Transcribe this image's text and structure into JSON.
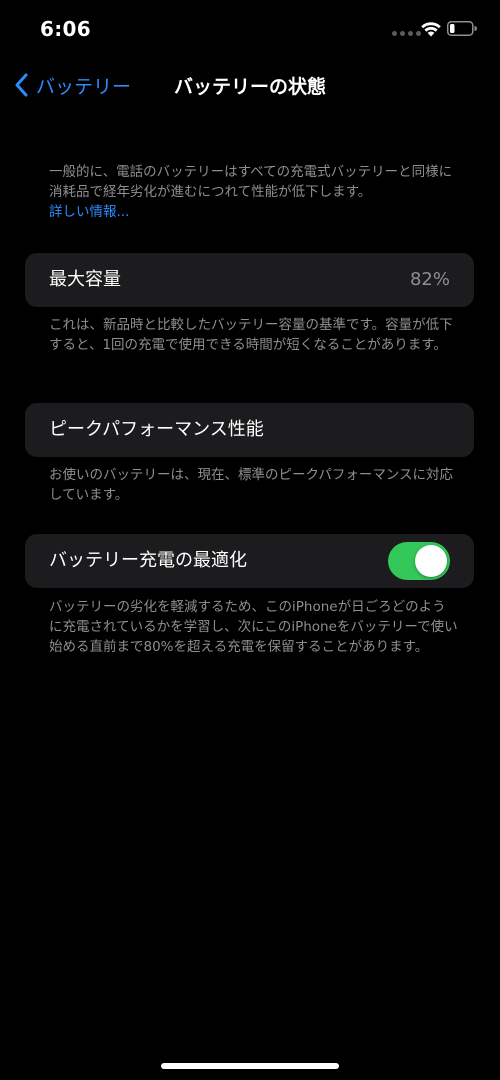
{
  "status_bar": {
    "time": "6:06",
    "icons": [
      "signal-dots-icon",
      "wifi-icon",
      "battery-icon"
    ]
  },
  "nav": {
    "back_label": "バッテリー",
    "title": "バッテリーの状態"
  },
  "intro": {
    "text": "一般的に、電話のバッテリーはすべての充電式バッテリーと同様に消耗品で経年劣化が進むにつれて性能が低下します。",
    "link": "詳しい情報..."
  },
  "max_capacity": {
    "label": "最大容量",
    "value": "82%",
    "footnote": "これは、新品時と比較したバッテリー容量の基準です。容量が低下すると、1回の充電で使用できる時間が短くなることがあります。"
  },
  "peak_performance": {
    "label": "ピークパフォーマンス性能",
    "footnote": "お使いのバッテリーは、現在、標準のピークパフォーマンスに対応しています。"
  },
  "optimized_charging": {
    "label": "バッテリー充電の最適化",
    "enabled": true,
    "footnote": "バッテリーの劣化を軽減するため、このiPhoneが日ごろどのように充電されているかを学習し、次にこのiPhoneをバッテリーで使い始める直前まで80%を超える充電を保留することがあります。"
  },
  "colors": {
    "background": "#000000",
    "card": "#1c1c1e",
    "accent": "#2c8cff",
    "toggle_on": "#34c759",
    "secondary_text": "#8e8e93"
  }
}
